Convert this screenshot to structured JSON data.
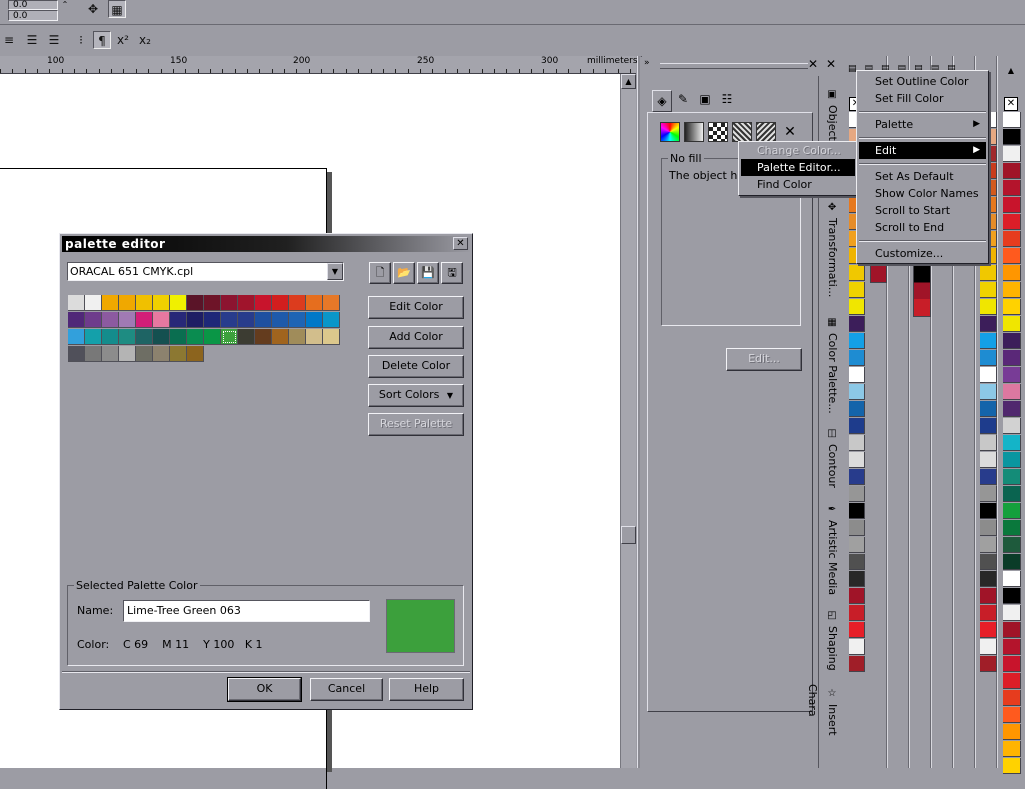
{
  "toolbar": {
    "pos_x": "0.0",
    "pos_y": "0.0"
  },
  "ruler": {
    "unit": "millimeters",
    "labels": [
      "100",
      "150",
      "200",
      "250",
      "300"
    ]
  },
  "palette_editor": {
    "title": "palette editor",
    "palette_file": "ORACAL 651 CMYK.cpl",
    "buttons": {
      "edit_color": "Edit Color",
      "add_color": "Add Color",
      "delete_color": "Delete Color",
      "sort_colors": "Sort Colors",
      "reset_palette": "Reset Palette",
      "ok": "OK",
      "cancel": "Cancel",
      "help": "Help"
    },
    "swatches": [
      [
        "#dcdcdc",
        "#f0f0f0",
        "#f0a800",
        "#f0a800",
        "#f0c000",
        "#f0d000",
        "#f0f000",
        "#5a1428",
        "#6e1428",
        "#8c1430",
        "#a0142c",
        "#c8142c",
        "#d21e1e",
        "#dc3c1e",
        "#e66e1e",
        "#e67828"
      ],
      [
        "#502878",
        "#6e3c8c",
        "#8c5aa0",
        "#a07ab4",
        "#d21e78",
        "#e678a0",
        "#282878",
        "#1e1e64",
        "#1e2878",
        "#283c8c",
        "#283c8c",
        "#1e50a0",
        "#1e5aaa",
        "#1e64b4",
        "#0078c8",
        "#0a96c8"
      ],
      [
        "#32a0dc",
        "#14a0aa",
        "#148c8c",
        "#1e8c82",
        "#1e6464",
        "#145050",
        "#0a6e50",
        "#0a8c50",
        "#0a9646",
        "#3ca03c",
        "#3c3c32",
        "#643c1e",
        "#a0641e",
        "#a08c5a",
        "#d2be8c",
        "#dcc88c"
      ],
      [
        "#50505a",
        "#787878",
        "#8c8c8c",
        "#b4b4b4",
        "#6e6e64",
        "#8c826e",
        "#8c7832",
        "#8c641e"
      ]
    ],
    "selected_group_label": "Selected Palette Color",
    "name_label": "Name:",
    "name_value": "Lime-Tree Green 063",
    "color_label": "Color:",
    "color_value": "C 69    M 11    Y 100   K 1",
    "selected_color": "#3ca03c"
  },
  "docker": {
    "fill_label": "No fill",
    "fill_desc": "The object has",
    "edit_button": "Edit...",
    "tabs": [
      "Object...",
      "Transformati...",
      "Color Palette...",
      "Contour",
      "Artistic Media",
      "Shaping",
      "Insert Chara"
    ]
  },
  "submenu_left": {
    "items": [
      "Change Color...",
      "Palette Editor...",
      "Find Color"
    ]
  },
  "context_menu": {
    "items": [
      "Set Outline Color",
      "Set Fill Color",
      "Palette",
      "Edit",
      "Set As Default",
      "Show Color Names",
      "Scroll to Start",
      "Scroll to End",
      "Customize..."
    ]
  },
  "palette_column": {
    "colors": [
      "#ffffff",
      "#e6a882",
      "#a0282c",
      "#c83c1e",
      "#d25a1e",
      "#e6781e",
      "#e68c28",
      "#f0a01e",
      "#f0b400",
      "#f0c800",
      "#f0d200",
      "#f0e600",
      "#3c1e5a",
      "#14a0e6",
      "#1e8cd2",
      "#ffffff",
      "#8cc8e6",
      "#1464aa",
      "#1e3c8c",
      "#c8c8c8",
      "#dcdcdc",
      "#283c8c",
      "#969696",
      "#000000",
      "#8c8c8c",
      "#a0a0a0",
      "#505050",
      "#282828",
      "#a01428",
      "#c81e28",
      "#e61e28",
      "#f0f0f0",
      "#a01e28"
    ]
  },
  "palette_column2": {
    "colors": [
      "#ffffff",
      "#000000",
      "#f0f0f0",
      "#a01428",
      "#b4142c",
      "#c8142c",
      "#dc1e28",
      "#e63c1e",
      "#ff5a1e",
      "#ff9600",
      "#ffb400",
      "#ffd200",
      "#f0e600",
      "#3c1e5a",
      "#5a2878",
      "#783c96",
      "#dc78a0",
      "#50286e",
      "#d2d2d2",
      "#14b4c8",
      "#0a96a0",
      "#148c78",
      "#0a6450",
      "#14a03c",
      "#0a783c",
      "#1e5a3c",
      "#0a3c28"
    ]
  }
}
